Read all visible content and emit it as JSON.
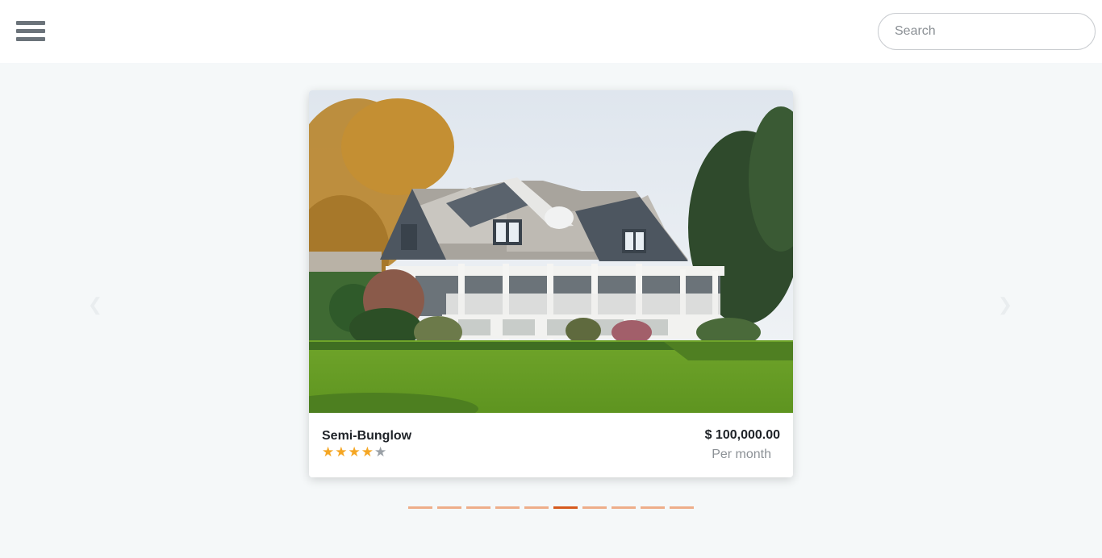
{
  "header": {
    "menu_icon": "hamburger-menu-icon",
    "search": {
      "placeholder": "Search",
      "value": ""
    }
  },
  "carousel": {
    "prev_icon": "chevron-left-icon",
    "next_icon": "chevron-right-icon",
    "active_index": 5,
    "slide_count": 10,
    "colors": {
      "dot": "#eeae8a",
      "dot_active": "#d65a1e"
    }
  },
  "listing": {
    "title": "Semi-Bunglow",
    "rating": 4,
    "rating_max": 5,
    "price": "$ 100,000.00",
    "price_period": "Per month",
    "colors": {
      "star_on": "#f5a623",
      "star_off": "#9aa0a6"
    }
  }
}
